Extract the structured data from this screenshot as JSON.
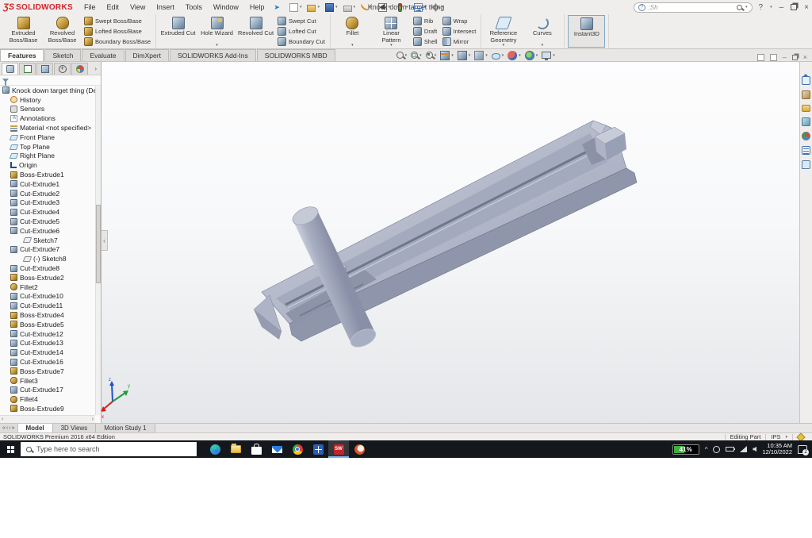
{
  "titlebar": {
    "brand": "SOLIDWORKS",
    "brand_mark": "ƷS",
    "title": "Knock down target thing",
    "command_value": ";Sh",
    "help_glyph": "?",
    "menus": [
      {
        "label": "File"
      },
      {
        "label": "Edit"
      },
      {
        "label": "View"
      },
      {
        "label": "Insert"
      },
      {
        "label": "Tools"
      },
      {
        "label": "Window"
      },
      {
        "label": "Help"
      }
    ],
    "quick_access": [
      {
        "name": "new-document-icon",
        "icon": "new",
        "caret": "y"
      },
      {
        "name": "open-icon",
        "icon": "open",
        "caret": "y"
      },
      {
        "name": "save-icon",
        "icon": "save",
        "caret": "y"
      },
      {
        "name": "print-icon",
        "icon": "print",
        "caret": "y"
      },
      {
        "name": "undo-icon",
        "icon": "undo",
        "caret": "y"
      },
      {
        "name": "select-cursor-icon",
        "icon": "select",
        "caret": "y",
        "state": "active"
      },
      {
        "name": "rebuild-icon",
        "icon": "rebuild"
      },
      {
        "name": "file-properties-icon",
        "icon": "props"
      },
      {
        "name": "options-gear-icon",
        "icon": "gear",
        "caret": "y"
      }
    ]
  },
  "ribbon": {
    "groups": [
      {
        "large": [
          {
            "label": "Extruded Boss/Base",
            "icon": "extboss",
            "name": "extruded-boss-base-button"
          },
          {
            "label": "Revolved Boss/Base",
            "icon": "revboss",
            "name": "revolved-boss-base-button"
          }
        ],
        "stack": [
          {
            "label": "Swept Boss/Base",
            "icon": "sweptboss",
            "name": "swept-boss-base-button"
          },
          {
            "label": "Lofted Boss/Base",
            "icon": "loftboss",
            "name": "lofted-boss-base-button"
          },
          {
            "label": "Boundary Boss/Base",
            "icon": "bndboss",
            "name": "boundary-boss-base-button"
          }
        ]
      },
      {
        "large": [
          {
            "label": "Extruded Cut",
            "icon": "extcut",
            "name": "extruded-cut-button"
          },
          {
            "label": "Hole Wizard",
            "icon": "holewiz",
            "caret": "y",
            "name": "hole-wizard-button"
          },
          {
            "label": "Revolved Cut",
            "icon": "revcut",
            "name": "revolved-cut-button"
          }
        ],
        "stack": [
          {
            "label": "Swept Cut",
            "icon": "sweptcut",
            "name": "swept-cut-button"
          },
          {
            "label": "Lofted Cut",
            "icon": "loftcut",
            "name": "lofted-cut-button"
          },
          {
            "label": "Boundary Cut",
            "icon": "bndcut",
            "name": "boundary-cut-button"
          }
        ]
      },
      {
        "large": [
          {
            "label": "Fillet",
            "icon": "fillet",
            "caret": "y",
            "name": "fillet-button"
          },
          {
            "label": "Linear Pattern",
            "icon": "linpat",
            "caret": "y",
            "name": "linear-pattern-button"
          }
        ],
        "stack": [
          {
            "label": "Rib",
            "icon": "rib",
            "name": "rib-button"
          },
          {
            "label": "Draft",
            "icon": "draft",
            "name": "draft-button"
          },
          {
            "label": "Shell",
            "icon": "shell",
            "name": "shell-button"
          }
        ],
        "stack2": [
          {
            "label": "Wrap",
            "icon": "wrap",
            "name": "wrap-button"
          },
          {
            "label": "Intersect",
            "icon": "intersect",
            "name": "intersect-button"
          },
          {
            "label": "Mirror",
            "icon": "mirror",
            "name": "mirror-button"
          }
        ]
      },
      {
        "large": [
          {
            "label": "Reference Geometry",
            "icon": "refgeo",
            "caret": "y",
            "name": "reference-geometry-button"
          },
          {
            "label": "Curves",
            "icon": "curves",
            "caret": "y",
            "name": "curves-button"
          }
        ]
      },
      {
        "large": [
          {
            "label": "Instant3D",
            "icon": "instant3d",
            "state": "active",
            "name": "instant3d-button"
          }
        ]
      }
    ]
  },
  "command_tabs": [
    {
      "label": "Features",
      "state": "active"
    },
    {
      "label": "Sketch"
    },
    {
      "label": "Evaluate"
    },
    {
      "label": "DimXpert"
    },
    {
      "label": "SOLIDWORKS Add-Ins"
    },
    {
      "label": "SOLIDWORKS MBD"
    }
  ],
  "view_toolbar": [
    {
      "name": "zoom-to-fit-icon",
      "icon": "zoomfit"
    },
    {
      "name": "zoom-to-area-icon",
      "icon": "zoomarea"
    },
    {
      "name": "previous-view-icon",
      "icon": "prevview"
    },
    {
      "name": "section-view-icon",
      "icon": "section",
      "caret": "y"
    },
    {
      "name": "view-orientation-icon",
      "icon": "orient",
      "caret": "y"
    },
    {
      "name": "display-style-icon",
      "icon": "display",
      "caret": "y"
    },
    {
      "name": "hide-show-items-icon",
      "icon": "hideshow",
      "caret": "y"
    },
    {
      "name": "edit-appearance-icon",
      "icon": "appearance"
    },
    {
      "name": "apply-scene-icon",
      "icon": "scene",
      "caret": "y"
    },
    {
      "name": "view-settings-icon",
      "icon": "viewsettings",
      "caret": "y"
    }
  ],
  "panel_tabs": [
    {
      "name": "featuremanager-tab-icon",
      "icon": "fm",
      "state": "active"
    },
    {
      "name": "propertymanager-tab-icon",
      "icon": "pm"
    },
    {
      "name": "configurationmanager-tab-icon",
      "icon": "cm"
    },
    {
      "name": "dimxpertmanager-tab-icon",
      "icon": "dx"
    },
    {
      "name": "displaymanager-tab-icon",
      "icon": "dm"
    }
  ],
  "tree": {
    "root_label": "Knock down target thing  (Default<< ",
    "items": [
      {
        "label": "History",
        "icon": "history",
        "arrow": "c",
        "lvl": 0
      },
      {
        "label": "Sensors",
        "icon": "sensors",
        "arrow": "n",
        "lvl": 0
      },
      {
        "label": "Annotations",
        "icon": "annot",
        "arrow": "c",
        "lvl": 0
      },
      {
        "label": "Material <not specified>",
        "icon": "material",
        "arrow": "n",
        "lvl": 0
      },
      {
        "label": "Front Plane",
        "icon": "plane",
        "arrow": "n",
        "lvl": 0
      },
      {
        "label": "Top Plane",
        "icon": "plane",
        "arrow": "n",
        "lvl": 0
      },
      {
        "label": "Right Plane",
        "icon": "plane",
        "arrow": "n",
        "lvl": 0
      },
      {
        "label": "Origin",
        "icon": "origin",
        "arrow": "n",
        "lvl": 0
      },
      {
        "label": "Boss-Extrude1",
        "icon": "boss",
        "arrow": "c",
        "lvl": 0
      },
      {
        "label": "Cut-Extrude1",
        "icon": "cut",
        "arrow": "c",
        "lvl": 0
      },
      {
        "label": "Cut-Extrude2",
        "icon": "cut",
        "arrow": "c",
        "lvl": 0
      },
      {
        "label": "Cut-Extrude3",
        "icon": "cut",
        "arrow": "c",
        "lvl": 0
      },
      {
        "label": "Cut-Extrude4",
        "icon": "cut",
        "arrow": "c",
        "lvl": 0
      },
      {
        "label": "Cut-Extrude5",
        "icon": "cut",
        "arrow": "c",
        "lvl": 0
      },
      {
        "label": "Cut-Extrude6",
        "icon": "cut",
        "arrow": "e",
        "lvl": 0
      },
      {
        "label": "Sketch7",
        "icon": "sketch",
        "arrow": "n",
        "lvl": 1
      },
      {
        "label": "Cut-Extrude7",
        "icon": "cut",
        "arrow": "e",
        "lvl": 0
      },
      {
        "label": "(-) Sketch8",
        "icon": "sketch",
        "arrow": "n",
        "lvl": 1
      },
      {
        "label": "Cut-Extrude8",
        "icon": "cut",
        "arrow": "c",
        "lvl": 0
      },
      {
        "label": "Boss-Extrude2",
        "icon": "boss",
        "arrow": "c",
        "lvl": 0
      },
      {
        "label": "Fillet2",
        "icon": "fillet",
        "arrow": "n",
        "lvl": 0
      },
      {
        "label": "Cut-Extrude10",
        "icon": "cut",
        "arrow": "c",
        "lvl": 0
      },
      {
        "label": "Cut-Extrude11",
        "icon": "cut",
        "arrow": "c",
        "lvl": 0
      },
      {
        "label": "Boss-Extrude4",
        "icon": "boss",
        "arrow": "c",
        "lvl": 0
      },
      {
        "label": "Boss-Extrude5",
        "icon": "boss",
        "arrow": "c",
        "lvl": 0
      },
      {
        "label": "Cut-Extrude12",
        "icon": "cut",
        "arrow": "c",
        "lvl": 0
      },
      {
        "label": "Cut-Extrude13",
        "icon": "cut",
        "arrow": "c",
        "lvl": 0
      },
      {
        "label": "Cut-Extrude14",
        "icon": "cut",
        "arrow": "c",
        "lvl": 0
      },
      {
        "label": "Cut-Extrude16",
        "icon": "cut",
        "arrow": "c",
        "lvl": 0
      },
      {
        "label": "Boss-Extrude7",
        "icon": "boss",
        "arrow": "c",
        "lvl": 0
      },
      {
        "label": "Fillet3",
        "icon": "fillet",
        "arrow": "n",
        "lvl": 0
      },
      {
        "label": "Cut-Extrude17",
        "icon": "cut",
        "arrow": "c",
        "lvl": 0
      },
      {
        "label": "Fillet4",
        "icon": "fillet",
        "arrow": "n",
        "lvl": 0
      },
      {
        "label": "Boss-Extrude9",
        "icon": "boss",
        "arrow": "c",
        "lvl": 0
      }
    ]
  },
  "task_pane": [
    {
      "name": "home-icon",
      "icon": "home"
    },
    {
      "name": "design-library-icon",
      "icon": "dlib"
    },
    {
      "name": "file-explorer-icon",
      "icon": "fexp"
    },
    {
      "name": "view-palette-icon",
      "icon": "vpal"
    },
    {
      "name": "appearances-icon",
      "icon": "appr"
    },
    {
      "name": "custom-properties-icon",
      "icon": "cprop"
    },
    {
      "name": "forum-icon",
      "icon": "forum"
    }
  ],
  "model_tabs": [
    {
      "label": "Model",
      "state": "active"
    },
    {
      "label": "3D Views"
    },
    {
      "label": "Motion Study 1"
    }
  ],
  "status": {
    "edition": "SOLIDWORKS Premium 2016 x64 Edition",
    "mode": "Editing Part",
    "units": "IPS"
  },
  "taskbar": {
    "search_placeholder": "Type here to search",
    "apps": [
      {
        "name": "edge-icon",
        "icon": "edge"
      },
      {
        "name": "file-explorer-icon",
        "icon": "explorer"
      },
      {
        "name": "store-icon",
        "icon": "store"
      },
      {
        "name": "mail-icon",
        "icon": "mail"
      },
      {
        "name": "chrome-icon",
        "icon": "chrome"
      },
      {
        "name": "grid-app-icon",
        "icon": "grid"
      },
      {
        "name": "solidworks-icon",
        "icon": "sw",
        "state": "active",
        "glyph": "SW"
      },
      {
        "name": "browser-icon",
        "icon": "opera"
      }
    ],
    "battery_percent": "41%",
    "time": "10:35 AM",
    "date": "12/10/2022",
    "notification_count": "2"
  }
}
